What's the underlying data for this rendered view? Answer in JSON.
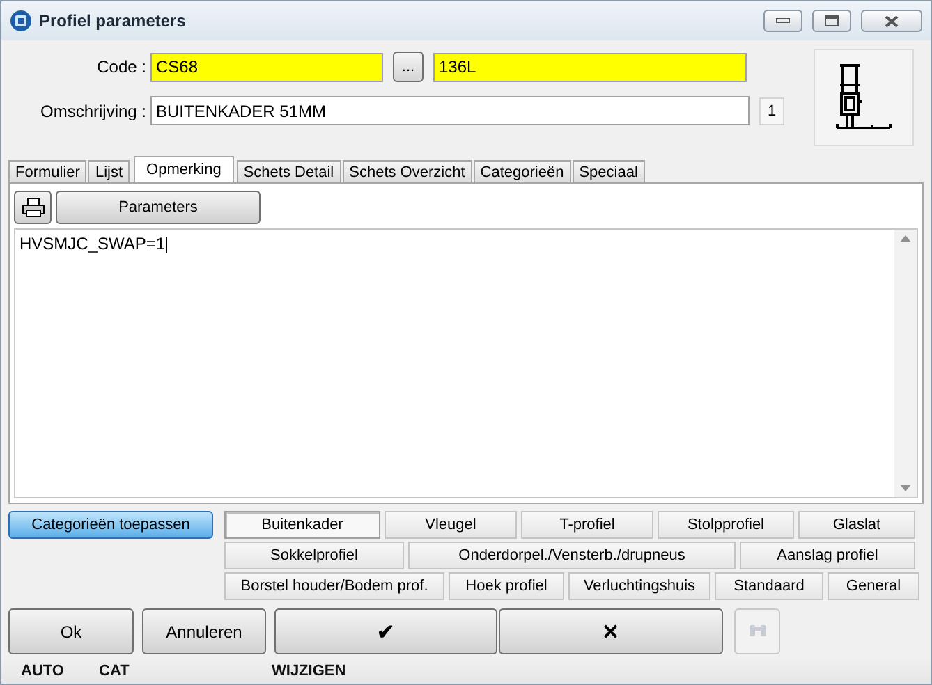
{
  "window": {
    "title": "Profiel parameters"
  },
  "code": {
    "label": "Code :",
    "value": "CS68",
    "browse_label": "...",
    "value_2": "136L"
  },
  "description": {
    "label": "Omschrijving :",
    "value": "BUITENKADER 51MM",
    "counter": "1"
  },
  "tabs": [
    {
      "label": "Formulier",
      "selected": false
    },
    {
      "label": "Lijst",
      "selected": false
    },
    {
      "label": "Opmerking",
      "selected": true
    },
    {
      "label": "Schets Detail",
      "selected": false
    },
    {
      "label": "Schets Overzicht",
      "selected": false
    },
    {
      "label": "Categorieën",
      "selected": false
    },
    {
      "label": "Speciaal",
      "selected": false
    }
  ],
  "toolbar": {
    "parameters_label": "Parameters"
  },
  "memo": {
    "text": "HVSMJC_SWAP=1"
  },
  "apply_categories": {
    "label": "Categorieën toepassen",
    "on": true
  },
  "category_rows": [
    [
      {
        "label": "Buitenkader",
        "selected": true
      },
      {
        "label": "Vleugel",
        "selected": false
      },
      {
        "label": "T-profiel",
        "selected": false
      },
      {
        "label": "Stolpprofiel",
        "selected": false
      },
      {
        "label": "Glaslat",
        "selected": false
      }
    ],
    [
      {
        "label": "Sokkelprofiel",
        "selected": false
      },
      {
        "label": "Onderdorpel./Vensterb./drupneus",
        "selected": false
      },
      {
        "label": "Aanslag profiel",
        "selected": false
      }
    ],
    [
      {
        "label": "Borstel houder/Bodem prof.",
        "selected": false
      },
      {
        "label": "Hoek profiel",
        "selected": false
      },
      {
        "label": "Verluchtingshuis",
        "selected": false
      },
      {
        "label": "Standaard",
        "selected": false
      },
      {
        "label": "General",
        "selected": false
      }
    ]
  ],
  "buttons": [
    {
      "kind": "text",
      "label": "Ok"
    },
    {
      "kind": "text",
      "label": "Annuleren"
    },
    {
      "kind": "glyph",
      "label": "✔"
    },
    {
      "kind": "glyph",
      "label": "✕"
    },
    {
      "kind": "find",
      "disabled": true
    }
  ],
  "status_bar": [
    "AUTO",
    "CAT",
    "WIJZIGEN"
  ]
}
